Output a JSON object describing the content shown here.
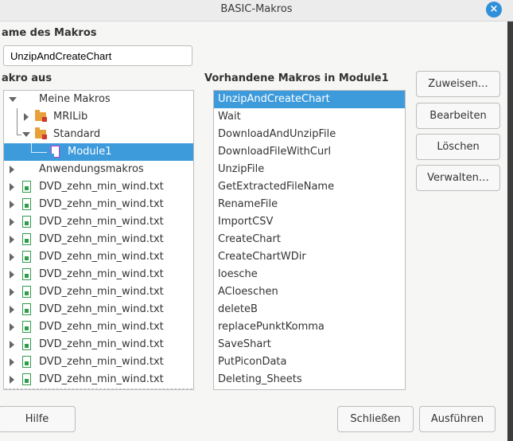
{
  "window": {
    "title": "BASIC-Makros",
    "close_symbol": "×"
  },
  "macro_name": {
    "label": "ame des Makros",
    "value": "UnzipAndCreateChart"
  },
  "macro_from": {
    "label": "akro aus",
    "tree": [
      {
        "label": "Meine Makros",
        "expanded": true
      },
      {
        "label": "MRILib",
        "expanded": false
      },
      {
        "label": "Standard",
        "expanded": true
      },
      {
        "label": "Module1",
        "selected": true
      },
      {
        "label": "Anwendungsmakros",
        "expanded": false
      },
      {
        "label": "DVD_zehn_min_wind.txt"
      },
      {
        "label": "DVD_zehn_min_wind.txt"
      },
      {
        "label": "DVD_zehn_min_wind.txt"
      },
      {
        "label": "DVD_zehn_min_wind.txt"
      },
      {
        "label": "DVD_zehn_min_wind.txt"
      },
      {
        "label": "DVD_zehn_min_wind.txt"
      },
      {
        "label": "DVD_zehn_min_wind.txt"
      },
      {
        "label": "DVD_zehn_min_wind.txt"
      },
      {
        "label": "DVD_zehn_min_wind.txt"
      },
      {
        "label": "DVD_zehn_min_wind.txt"
      },
      {
        "label": "DVD_zehn_min_wind.txt"
      },
      {
        "label": "DVD_zehn_min_wind.txt"
      }
    ]
  },
  "existing_macros": {
    "label": "Vorhandene Makros in Module1",
    "items": [
      "UnzipAndCreateChart",
      "Wait",
      "DownloadAndUnzipFile",
      "DownloadFileWithCurl",
      "UnzipFile",
      "GetExtractedFileName",
      "RenameFile",
      "ImportCSV",
      "CreateChart",
      "CreateChartWDir",
      "loesche",
      "ACloeschen",
      "deleteB",
      "replacePunktKomma",
      "SaveShart",
      "PutPiconData",
      "Deleting_Sheets"
    ],
    "selected_index": 0
  },
  "side_buttons": {
    "assign": "Zuweisen…",
    "edit": "Bearbeiten",
    "delete": "Löschen",
    "manage": "Verwalten…"
  },
  "footer": {
    "help": "Hilfe",
    "close": "Schließen",
    "run": "Ausführen"
  },
  "colors": {
    "selection": "#3d9bdc",
    "close_button": "#2f8fd8"
  }
}
